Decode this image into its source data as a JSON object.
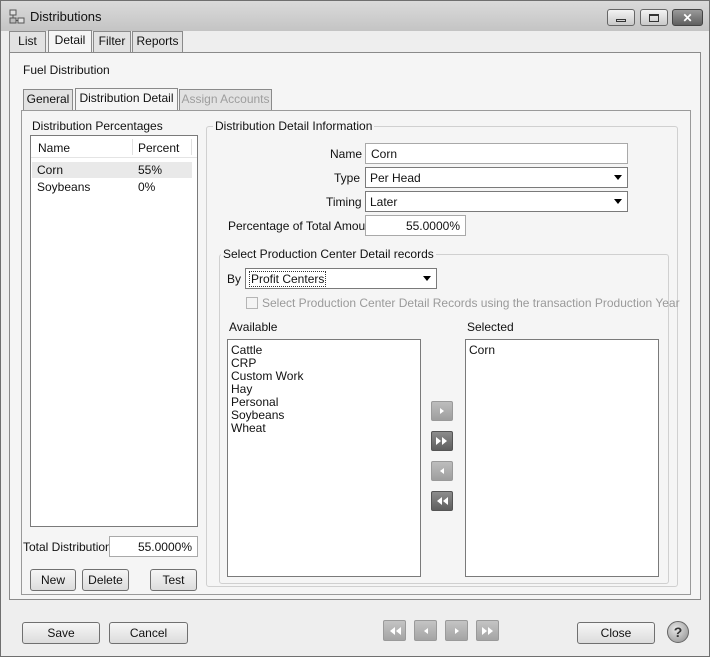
{
  "window": {
    "title": "Distributions"
  },
  "main_tabs": [
    "List",
    "Detail",
    "Filter",
    "Reports"
  ],
  "section_title": "Fuel Distribution",
  "sub_tabs": [
    "General",
    "Distribution Detail",
    "Assign Accounts"
  ],
  "percentages": {
    "caption": "Distribution Percentages",
    "col_name": "Name",
    "col_percent": "Percent",
    "rows": [
      {
        "name": "Corn",
        "percent": "55%"
      },
      {
        "name": "Soybeans",
        "percent": "0%"
      }
    ],
    "total_label": "Total Distribution",
    "total_value": "55.0000%",
    "new_label": "New",
    "delete_label": "Delete",
    "test_label": "Test"
  },
  "detail": {
    "caption": "Distribution Detail Information",
    "name_label": "Name",
    "name_value": "Corn",
    "type_label": "Type",
    "type_value": "Per Head",
    "timing_label": "Timing",
    "timing_value": "Later",
    "pct_label": "Percentage of Total Amount",
    "pct_value": "55.0000%"
  },
  "production": {
    "caption": "Select Production Center Detail records",
    "by_label": "By",
    "by_value": "Profit Centers",
    "checkbox_label": "Select Production Center Detail Records using the transaction Production Year",
    "available_label": "Available",
    "available_items": [
      "Cattle",
      "CRP",
      "Custom Work",
      "Hay",
      "Personal",
      "Soybeans",
      "Wheat"
    ],
    "selected_label": "Selected",
    "selected_items": [
      "Corn"
    ]
  },
  "footer": {
    "save_label": "Save",
    "cancel_label": "Cancel",
    "close_label": "Close",
    "help_glyph": "?"
  },
  "icons": {
    "move_right": "move-right-icon",
    "move_all_right": "move-all-right-icon",
    "move_left": "move-left-icon",
    "move_all_left": "move-all-left-icon"
  }
}
